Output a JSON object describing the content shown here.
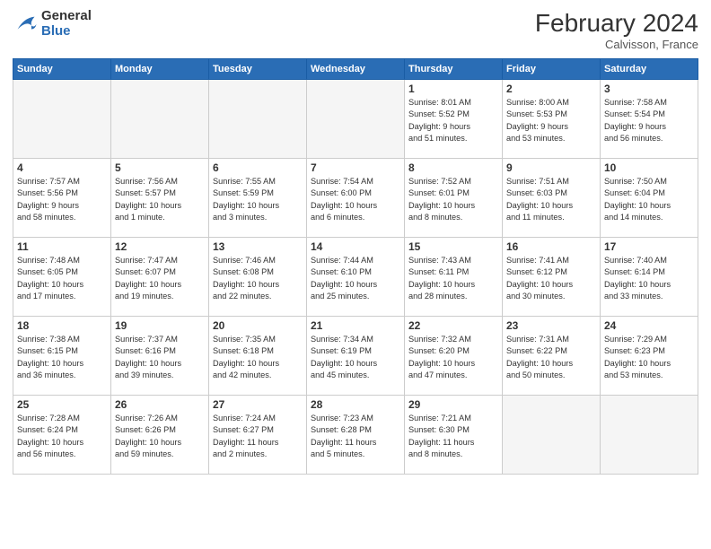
{
  "header": {
    "logo": {
      "general": "General",
      "blue": "Blue"
    },
    "title": "February 2024",
    "location": "Calvisson, France"
  },
  "weekdays": [
    "Sunday",
    "Monday",
    "Tuesday",
    "Wednesday",
    "Thursday",
    "Friday",
    "Saturday"
  ],
  "weeks": [
    [
      {
        "day": "",
        "info": "",
        "empty": true
      },
      {
        "day": "",
        "info": "",
        "empty": true
      },
      {
        "day": "",
        "info": "",
        "empty": true
      },
      {
        "day": "",
        "info": "",
        "empty": true
      },
      {
        "day": "1",
        "info": "Sunrise: 8:01 AM\nSunset: 5:52 PM\nDaylight: 9 hours\nand 51 minutes."
      },
      {
        "day": "2",
        "info": "Sunrise: 8:00 AM\nSunset: 5:53 PM\nDaylight: 9 hours\nand 53 minutes."
      },
      {
        "day": "3",
        "info": "Sunrise: 7:58 AM\nSunset: 5:54 PM\nDaylight: 9 hours\nand 56 minutes."
      }
    ],
    [
      {
        "day": "4",
        "info": "Sunrise: 7:57 AM\nSunset: 5:56 PM\nDaylight: 9 hours\nand 58 minutes."
      },
      {
        "day": "5",
        "info": "Sunrise: 7:56 AM\nSunset: 5:57 PM\nDaylight: 10 hours\nand 1 minute."
      },
      {
        "day": "6",
        "info": "Sunrise: 7:55 AM\nSunset: 5:59 PM\nDaylight: 10 hours\nand 3 minutes."
      },
      {
        "day": "7",
        "info": "Sunrise: 7:54 AM\nSunset: 6:00 PM\nDaylight: 10 hours\nand 6 minutes."
      },
      {
        "day": "8",
        "info": "Sunrise: 7:52 AM\nSunset: 6:01 PM\nDaylight: 10 hours\nand 8 minutes."
      },
      {
        "day": "9",
        "info": "Sunrise: 7:51 AM\nSunset: 6:03 PM\nDaylight: 10 hours\nand 11 minutes."
      },
      {
        "day": "10",
        "info": "Sunrise: 7:50 AM\nSunset: 6:04 PM\nDaylight: 10 hours\nand 14 minutes."
      }
    ],
    [
      {
        "day": "11",
        "info": "Sunrise: 7:48 AM\nSunset: 6:05 PM\nDaylight: 10 hours\nand 17 minutes."
      },
      {
        "day": "12",
        "info": "Sunrise: 7:47 AM\nSunset: 6:07 PM\nDaylight: 10 hours\nand 19 minutes."
      },
      {
        "day": "13",
        "info": "Sunrise: 7:46 AM\nSunset: 6:08 PM\nDaylight: 10 hours\nand 22 minutes."
      },
      {
        "day": "14",
        "info": "Sunrise: 7:44 AM\nSunset: 6:10 PM\nDaylight: 10 hours\nand 25 minutes."
      },
      {
        "day": "15",
        "info": "Sunrise: 7:43 AM\nSunset: 6:11 PM\nDaylight: 10 hours\nand 28 minutes."
      },
      {
        "day": "16",
        "info": "Sunrise: 7:41 AM\nSunset: 6:12 PM\nDaylight: 10 hours\nand 30 minutes."
      },
      {
        "day": "17",
        "info": "Sunrise: 7:40 AM\nSunset: 6:14 PM\nDaylight: 10 hours\nand 33 minutes."
      }
    ],
    [
      {
        "day": "18",
        "info": "Sunrise: 7:38 AM\nSunset: 6:15 PM\nDaylight: 10 hours\nand 36 minutes."
      },
      {
        "day": "19",
        "info": "Sunrise: 7:37 AM\nSunset: 6:16 PM\nDaylight: 10 hours\nand 39 minutes."
      },
      {
        "day": "20",
        "info": "Sunrise: 7:35 AM\nSunset: 6:18 PM\nDaylight: 10 hours\nand 42 minutes."
      },
      {
        "day": "21",
        "info": "Sunrise: 7:34 AM\nSunset: 6:19 PM\nDaylight: 10 hours\nand 45 minutes."
      },
      {
        "day": "22",
        "info": "Sunrise: 7:32 AM\nSunset: 6:20 PM\nDaylight: 10 hours\nand 47 minutes."
      },
      {
        "day": "23",
        "info": "Sunrise: 7:31 AM\nSunset: 6:22 PM\nDaylight: 10 hours\nand 50 minutes."
      },
      {
        "day": "24",
        "info": "Sunrise: 7:29 AM\nSunset: 6:23 PM\nDaylight: 10 hours\nand 53 minutes."
      }
    ],
    [
      {
        "day": "25",
        "info": "Sunrise: 7:28 AM\nSunset: 6:24 PM\nDaylight: 10 hours\nand 56 minutes."
      },
      {
        "day": "26",
        "info": "Sunrise: 7:26 AM\nSunset: 6:26 PM\nDaylight: 10 hours\nand 59 minutes."
      },
      {
        "day": "27",
        "info": "Sunrise: 7:24 AM\nSunset: 6:27 PM\nDaylight: 11 hours\nand 2 minutes."
      },
      {
        "day": "28",
        "info": "Sunrise: 7:23 AM\nSunset: 6:28 PM\nDaylight: 11 hours\nand 5 minutes."
      },
      {
        "day": "29",
        "info": "Sunrise: 7:21 AM\nSunset: 6:30 PM\nDaylight: 11 hours\nand 8 minutes."
      },
      {
        "day": "",
        "info": "",
        "empty": true
      },
      {
        "day": "",
        "info": "",
        "empty": true
      }
    ]
  ]
}
